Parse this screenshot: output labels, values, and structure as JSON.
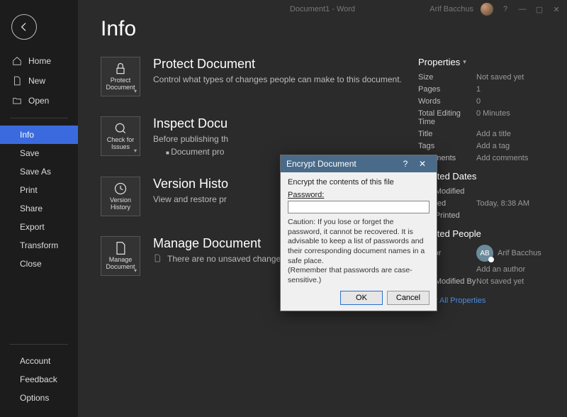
{
  "titlebar": {
    "doc_name": "Document1",
    "app_name": "Word",
    "user_name": "Arif Bacchus"
  },
  "sidebar": {
    "home": "Home",
    "new": "New",
    "open": "Open",
    "info": "Info",
    "save": "Save",
    "save_as": "Save As",
    "print": "Print",
    "share": "Share",
    "export": "Export",
    "transform": "Transform",
    "close": "Close",
    "account": "Account",
    "feedback": "Feedback",
    "options": "Options"
  },
  "page": {
    "title": "Info"
  },
  "tiles": {
    "protect": "Protect\nDocument",
    "check": "Check for\nIssues",
    "version": "Version\nHistory",
    "manage": "Manage\nDocument"
  },
  "sections": {
    "protect": {
      "title": "Protect Document",
      "desc": "Control what types of changes people can make to this document."
    },
    "inspect": {
      "title": "Inspect Docu",
      "desc": "Before publishing th",
      "bullet": "Document pro"
    },
    "version": {
      "title": "Version Histo",
      "desc": "View and restore pr"
    },
    "manage": {
      "title": "Manage Document",
      "desc": "There are no unsaved changes."
    }
  },
  "properties": {
    "header": "Properties",
    "rows": {
      "size_k": "Size",
      "size_v": "Not saved yet",
      "pages_k": "Pages",
      "pages_v": "1",
      "words_k": "Words",
      "words_v": "0",
      "time_k": "Total Editing Time",
      "time_v": "0 Minutes",
      "title_k": "Title",
      "title_v": "Add a title",
      "tags_k": "Tags",
      "tags_v": "Add a tag",
      "comments_k": "Comments",
      "comments_v": "Add comments"
    },
    "related_dates": "Related Dates",
    "dates": {
      "lastmod_k": "Last Modified",
      "lastmod_v": "",
      "created_k": "Created",
      "created_v": "Today, 8:38 AM",
      "lastprint_k": "Last Printed",
      "lastprint_v": ""
    },
    "related_people": "Related People",
    "author_k": "Author",
    "author_initials": "AB",
    "author_name": "Arif Bacchus",
    "add_author": "Add an author",
    "lastmodby_k": "Last Modified By",
    "lastmodby_v": "Not saved yet",
    "show_all": "Show All Properties"
  },
  "dialog": {
    "title": "Encrypt Document",
    "instr": "Encrypt the contents of this file",
    "pw_label": "Password:",
    "caution": "Caution: If you lose or forget the password, it cannot be recovered. It is advisable to keep a list of passwords and their corresponding document names in a safe place.\n(Remember that passwords are case-sensitive.)",
    "ok": "OK",
    "cancel": "Cancel"
  }
}
